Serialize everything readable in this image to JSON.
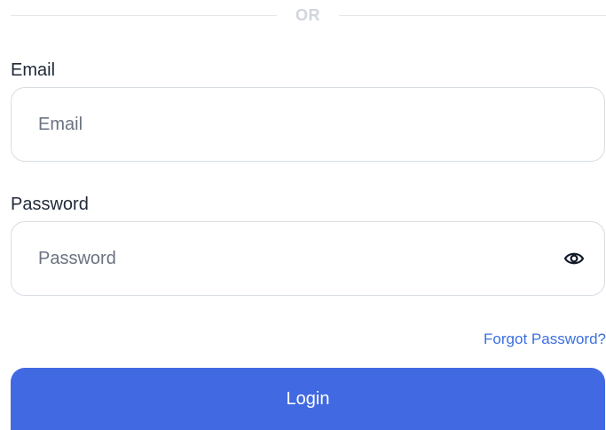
{
  "divider": {
    "text": "OR"
  },
  "email": {
    "label": "Email",
    "placeholder": "Email",
    "value": ""
  },
  "password": {
    "label": "Password",
    "placeholder": "Password",
    "value": "",
    "toggle_icon": "eye-icon"
  },
  "forgot_password": {
    "label": "Forgot Password?"
  },
  "login_button": {
    "label": "Login"
  },
  "colors": {
    "primary": "#4169e1",
    "link": "#3b6fe0",
    "border": "#d8dde3",
    "placeholder": "#6b7280"
  }
}
